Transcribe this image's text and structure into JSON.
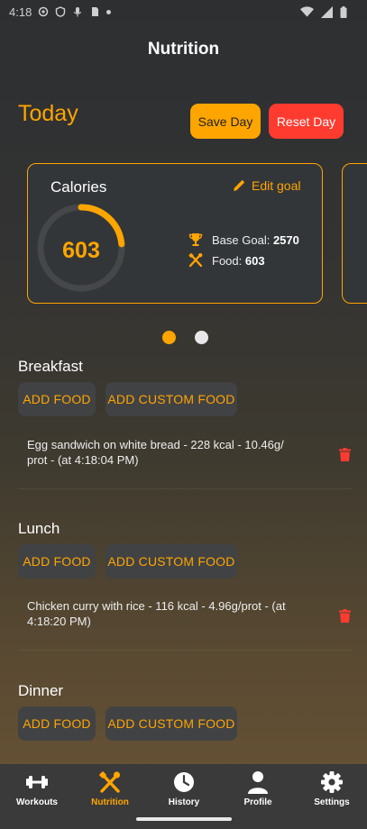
{
  "status_bar": {
    "time": "4:18"
  },
  "header": {
    "title": "Nutrition"
  },
  "today": {
    "label": "Today",
    "save_label": "Save Day",
    "reset_label": "Reset Day"
  },
  "calories_card": {
    "title": "Calories",
    "edit_label": "Edit goal",
    "value": "603",
    "base_goal_label": "Base Goal:",
    "base_goal_value": "2570",
    "food_label": "Food:",
    "food_value": "603",
    "progress_fraction": 0.2346
  },
  "pager": {
    "pages": 2,
    "active": 0
  },
  "meals": [
    {
      "title": "Breakfast",
      "add_food_label": "ADD FOOD",
      "add_custom_label": "ADD CUSTOM FOOD",
      "entries": [
        {
          "line1": "Egg sandwich on white bread - 228 kcal  - 10.46g/",
          "line2": "prot - (at 4:18:04 PM)"
        }
      ]
    },
    {
      "title": "Lunch",
      "add_food_label": "ADD FOOD",
      "add_custom_label": "ADD CUSTOM FOOD",
      "entries": [
        {
          "line1": "Chicken curry with rice - 116 kcal  - 4.96g/prot - (at",
          "line2": "4:18:20 PM)"
        }
      ]
    },
    {
      "title": "Dinner",
      "add_food_label": "ADD FOOD",
      "add_custom_label": "ADD CUSTOM FOOD"
    }
  ],
  "nav": {
    "items": [
      {
        "label": "Workouts",
        "icon": "dumbbell-icon"
      },
      {
        "label": "Nutrition",
        "icon": "fork-knife-icon"
      },
      {
        "label": "History",
        "icon": "clock-icon"
      },
      {
        "label": "Profile",
        "icon": "person-icon"
      },
      {
        "label": "Settings",
        "icon": "gear-icon"
      }
    ],
    "active_index": 1
  },
  "colors": {
    "accent": "#ffa500",
    "danger": "#ff3b30",
    "card_bg": "#333639",
    "nav_bg": "#3a3a3a"
  }
}
